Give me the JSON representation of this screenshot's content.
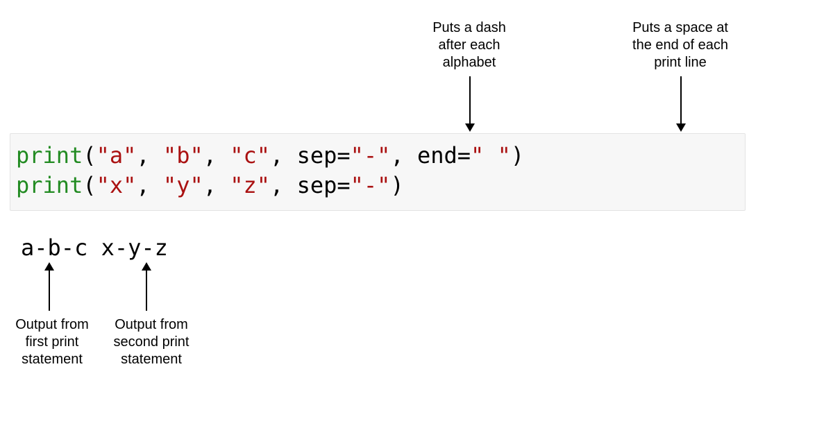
{
  "annotations": {
    "sep": "Puts a dash\nafter each\nalphabet",
    "end": "Puts a space at\nthe end of each\nprint line",
    "out1": "Output from\nfirst print\nstatement",
    "out2": "Output from\nsecond print\nstatement"
  },
  "code": {
    "line1": {
      "fn": "print",
      "open": "(",
      "arg1": "\"a\"",
      "c1": ", ",
      "arg2": "\"b\"",
      "c2": ", ",
      "arg3": "\"c\"",
      "c3": ", ",
      "sep_key": "sep",
      "eq1": "=",
      "sep_val": "\"-\"",
      "c4": ", ",
      "end_key": "end",
      "eq2": "=",
      "end_val": "\" \"",
      "close": ")"
    },
    "line2": {
      "fn": "print",
      "open": "(",
      "arg1": "\"x\"",
      "c1": ", ",
      "arg2": "\"y\"",
      "c2": ", ",
      "arg3": "\"z\"",
      "c3": ", ",
      "sep_key": "sep",
      "eq1": "=",
      "sep_val": "\"-\"",
      "close": ")"
    }
  },
  "output": "a-b-c x-y-z"
}
